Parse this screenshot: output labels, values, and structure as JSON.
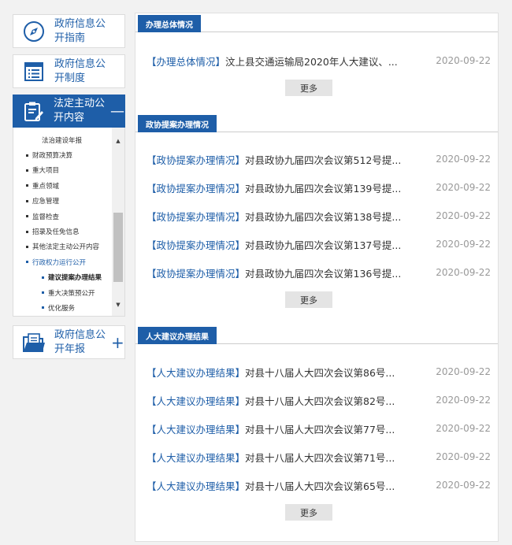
{
  "sidebar": {
    "guide": {
      "label": "政府信息公开指南",
      "icon": "compass-icon"
    },
    "system": {
      "label": "政府信息公开制度",
      "icon": "list-document-icon"
    },
    "active": {
      "label": "法定主动公开内容",
      "icon": "clipboard-edit-icon",
      "toggle": "—"
    },
    "annual": {
      "label": "政府信息公开年报",
      "icon": "folder-document-icon",
      "toggle": "+"
    },
    "submenu": [
      {
        "label": "法治建设年报",
        "level": 2
      },
      {
        "label": "财政预算决算",
        "level": 1
      },
      {
        "label": "重大项目",
        "level": 1
      },
      {
        "label": "重点领域",
        "level": 1
      },
      {
        "label": "应急管理",
        "level": 1
      },
      {
        "label": "监督检查",
        "level": 1
      },
      {
        "label": "招录及任免信息",
        "level": 1
      },
      {
        "label": "其他法定主动公开内容",
        "level": 1
      },
      {
        "label": "行政权力运行公开",
        "level": 1,
        "highlight": true
      },
      {
        "label": "建议提案办理结果",
        "level": 2,
        "current": true
      },
      {
        "label": "重大决策预公开",
        "level": 2
      },
      {
        "label": "优化服务",
        "level": 2
      }
    ]
  },
  "sections": [
    {
      "title": "办理总体情况",
      "items": [
        {
          "tag": "【办理总体情况】",
          "text": "汶上县交通运输局2020年人大建议、...",
          "date": "2020-09-22"
        }
      ],
      "more_label": "更多"
    },
    {
      "title": "政协提案办理情况",
      "items": [
        {
          "tag": "【政协提案办理情况】",
          "text": "对县政协九届四次会议第512号提...",
          "date": "2020-09-22"
        },
        {
          "tag": "【政协提案办理情况】",
          "text": "对县政协九届四次会议第139号提...",
          "date": "2020-09-22"
        },
        {
          "tag": "【政协提案办理情况】",
          "text": "对县政协九届四次会议第138号提...",
          "date": "2020-09-22"
        },
        {
          "tag": "【政协提案办理情况】",
          "text": "对县政协九届四次会议第137号提...",
          "date": "2020-09-22"
        },
        {
          "tag": "【政协提案办理情况】",
          "text": "对县政协九届四次会议第136号提...",
          "date": "2020-09-22"
        }
      ],
      "more_label": "更多"
    },
    {
      "title": "人大建议办理结果",
      "items": [
        {
          "tag": "【人大建议办理结果】",
          "text": "对县十八届人大四次会议第86号...",
          "date": "2020-09-22"
        },
        {
          "tag": "【人大建议办理结果】",
          "text": "对县十八届人大四次会议第82号...",
          "date": "2020-09-22"
        },
        {
          "tag": "【人大建议办理结果】",
          "text": "对县十八届人大四次会议第77号...",
          "date": "2020-09-22"
        },
        {
          "tag": "【人大建议办理结果】",
          "text": "对县十八届人大四次会议第71号...",
          "date": "2020-09-22"
        },
        {
          "tag": "【人大建议办理结果】",
          "text": "对县十八届人大四次会议第65号...",
          "date": "2020-09-22"
        }
      ],
      "more_label": "更多"
    }
  ],
  "colors": {
    "accent": "#1e5ea8",
    "date": "#999999",
    "more_bg": "#e4e4e4"
  }
}
